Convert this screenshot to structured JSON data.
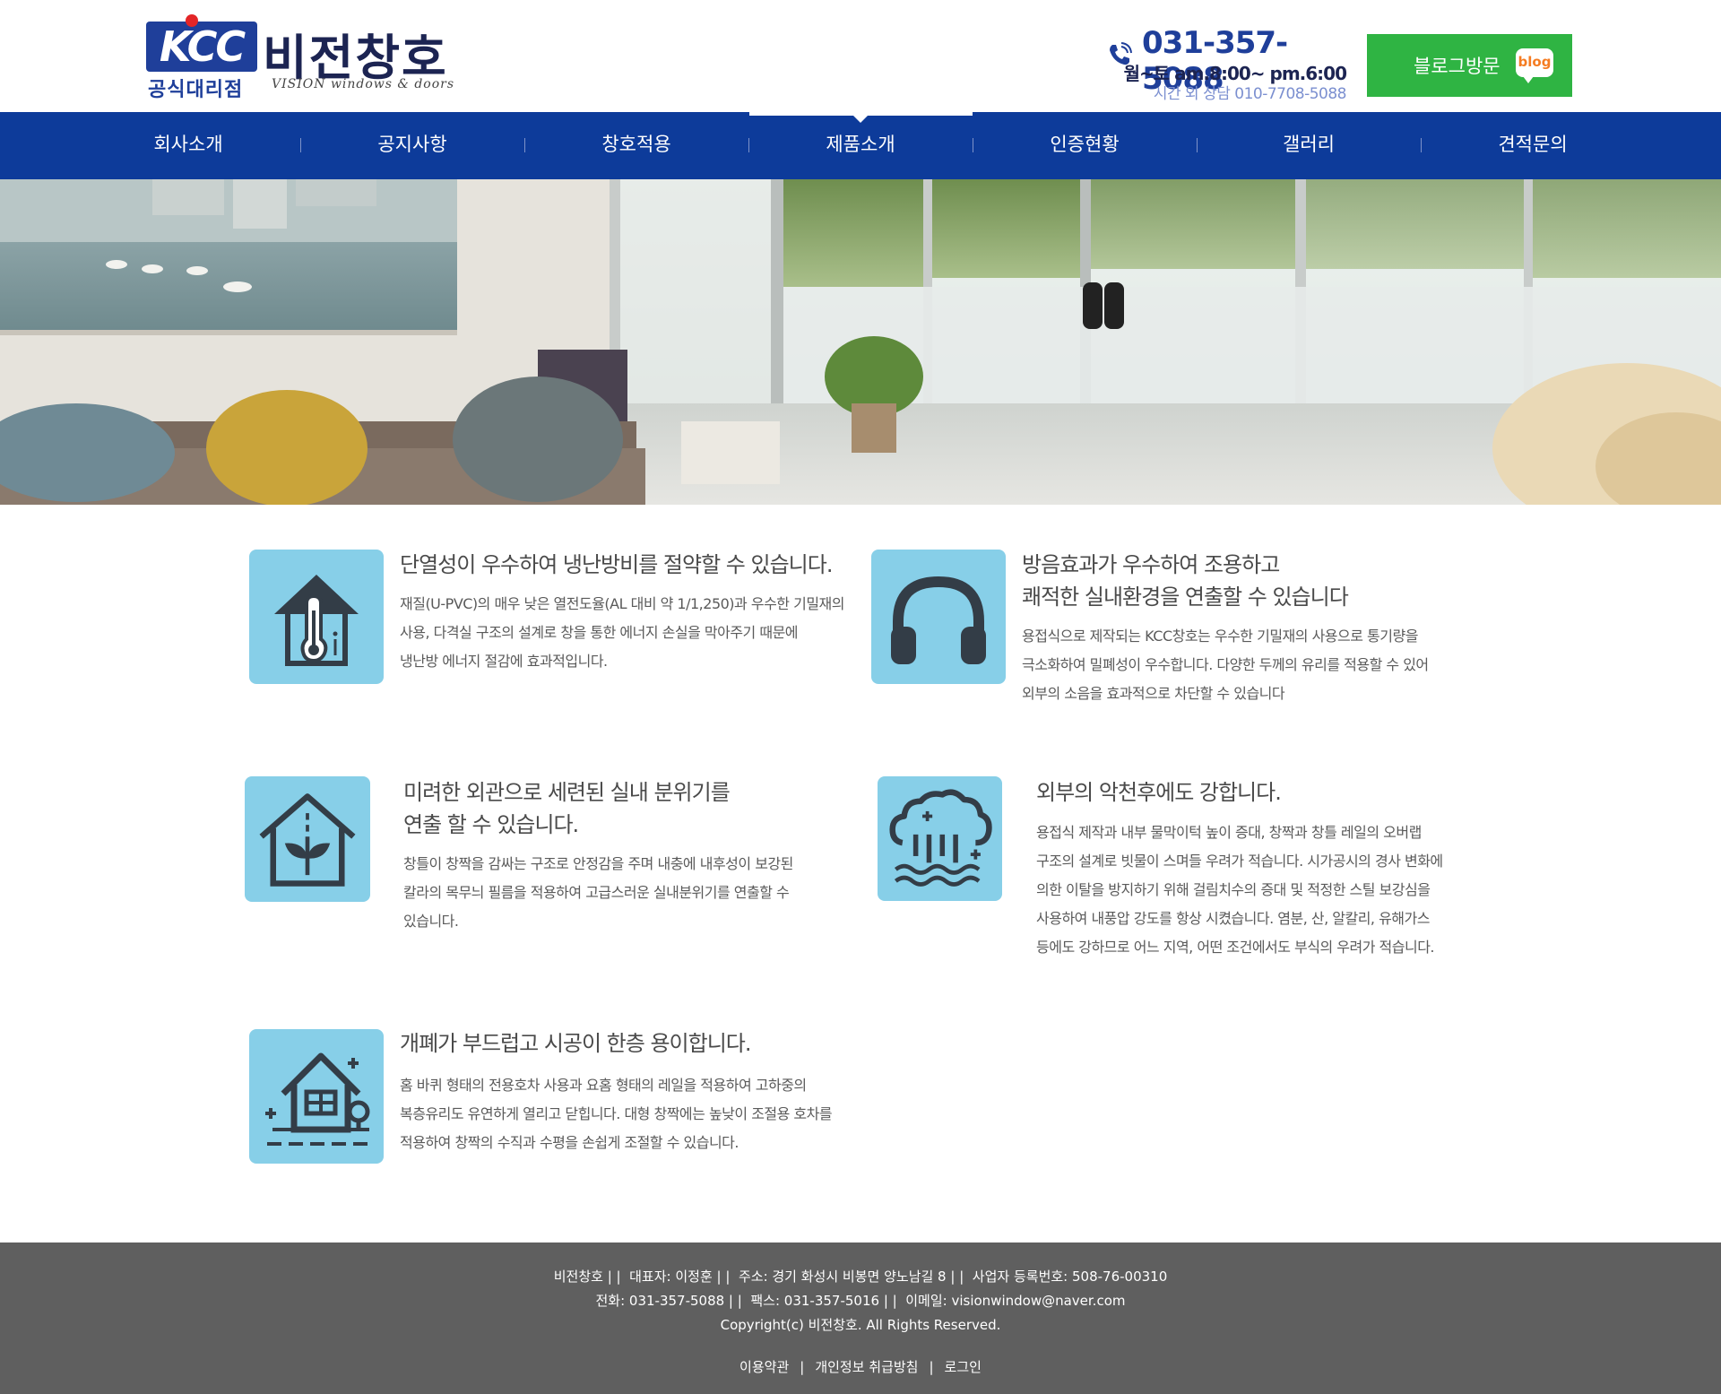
{
  "brand": {
    "kcc": "KCC",
    "kcc_sub": "공식대리점",
    "name": "비전창호",
    "name_en": "VISION windows & doors"
  },
  "contact": {
    "phone": "031-357-5088",
    "hours": "월~토 am.8:00~ pm.6:00",
    "after_hours": "시간 외 상담 010-7708-5088"
  },
  "blog_button": {
    "label": "블로그방문",
    "icon_text": "blog"
  },
  "nav": {
    "items": [
      {
        "label": "회사소개"
      },
      {
        "label": "공지사항"
      },
      {
        "label": "창호적용"
      },
      {
        "label": "제품소개"
      },
      {
        "label": "인증현황"
      },
      {
        "label": "갤러리"
      },
      {
        "label": "견적문의"
      }
    ],
    "active_index": 3
  },
  "features": [
    {
      "icon": "thermometer-house-icon",
      "title_lines": [
        "단열성이 우수하여 냉난방비를 절약할 수 있습니다."
      ],
      "desc_lines": [
        "재질(U-PVC)의 매우 낮은 열전도율(AL 대비 약 1/1,250)과 우수한 기밀재의",
        "사용, 다격실 구조의 설계로 창을 통한 에너지 손실을 막아주기 때문에",
        "냉난방 에너지 절감에 효과적입니다."
      ]
    },
    {
      "icon": "headphones-icon",
      "title_lines": [
        "방음효과가 우수하여 조용하고",
        "쾌적한 실내환경을 연출할 수 있습니다"
      ],
      "desc_lines": [
        "용접식으로 제작되는 KCC창호는 우수한 기밀재의 사용으로 통기량을",
        "극소화하여 밀폐성이 우수합니다. 다양한 두께의 유리를 적용할 수 있어",
        "외부의 소음을 효과적으로 차단할 수 있습니다"
      ]
    },
    {
      "icon": "plant-house-icon",
      "title_lines": [
        "미려한 외관으로 세련된 실내 분위기를",
        "연출 할 수 있습니다."
      ],
      "desc_lines": [
        "창틀이 창짝을 감싸는 구조로 안정감을 주며 내충에 내후성이 보강된",
        "칼라의 목무늬 필름을 적용하여 고급스러운 실내분위기를 연출할 수",
        "있습니다."
      ]
    },
    {
      "icon": "rain-cloud-icon",
      "title_lines": [
        "외부의 악천후에도 강합니다."
      ],
      "desc_lines": [
        "용접식 제작과 내부 물막이턱 높이 증대, 창짝과 창틀 레일의 오버랩",
        "구조의 설계로 빗물이 스며들 우려가 적습니다. 시가공시의 경사 변화에",
        "의한 이탈을 방지하기 위해 걸림치수의 증대 및 적정한 스틸 보강심을",
        "사용하여 내풍압 강도를 항상 시켰습니다. 염분, 산, 알칼리, 유해가스",
        "등에도 강하므로 어느 지역, 어떤 조건에서도 부식의 우려가 적습니다."
      ]
    },
    {
      "icon": "house-window-icon",
      "title_lines": [
        "개폐가 부드럽고 시공이 한층 용이합니다."
      ],
      "desc_lines": [
        "홈 바퀴 형태의 전용호차 사용과 요홈 형태의 레일을 적용하여 고하중의",
        "복층유리도 유연하게 열리고 닫힙니다. 대형 창짝에는 높낮이 조절용 호차를",
        "적용하여 창짝의 수직과 수평을 손쉽게 조절할 수 있습니다."
      ]
    }
  ],
  "footer": {
    "line1": [
      "비전창호 |",
      "|  대표자: 이정훈 |",
      "|  주소: 경기 화성시 비봉면 양노남길 8 |",
      "|  사업자 등록번호: 508-76-00310"
    ],
    "line2": [
      "전화: 031-357-5088 |",
      "|  팩스: 031-357-5016 |",
      "|  이메일: visionwindow@naver.com"
    ],
    "copyright": "Copyright(c) 비전창호. All Rights Reserved.",
    "links": [
      "이용약관",
      "개인정보 취급방침",
      "로그인"
    ]
  },
  "colors": {
    "nav_bg": "#0d3b9a",
    "brand_blue": "#1f3f9a",
    "kcc_red": "#e32527",
    "blog_green": "#2fb443",
    "icon_bg": "#87cfe8",
    "icon_stroke": "#333d47",
    "footer_bg": "#5f5f5f"
  }
}
